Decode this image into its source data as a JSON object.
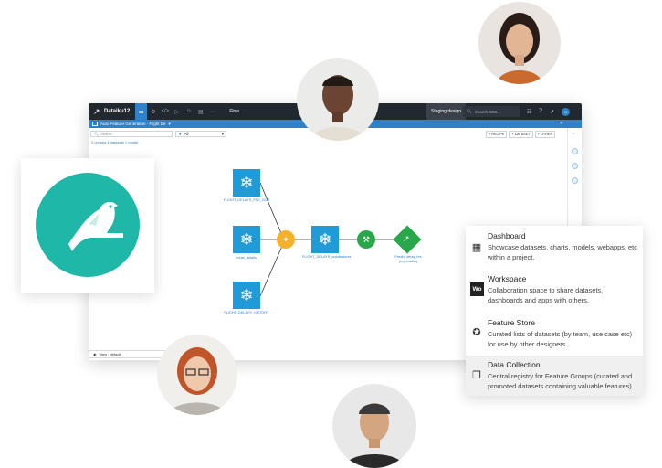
{
  "app": {
    "name": "Dataiku12",
    "nav_label": "Flow",
    "staging_label": "Staging design",
    "search_placeholder": "Search DSS...",
    "avatar_initial": "G"
  },
  "project": {
    "title": "Auto Feature Generation - Flight De"
  },
  "filter": {
    "search_placeholder": "Search",
    "selected": "All",
    "summary": "2 recipes 4 datasets 1 model"
  },
  "actions": {
    "recipe": "+ RECIPE",
    "dataset": "+ DATASET",
    "other": "+ OTHER"
  },
  "view": {
    "label": "View : default"
  },
  "flow": {
    "nodes": {
      "flight_delays_2022": "FLIGHT_DELAYS_FEE_2022",
      "route_details": "route_details",
      "flight_delays_history": "FLIGHT_DELAYS_HISTORY",
      "autofeatures": "FLIGHT_DELAYS_autofeatures",
      "predict": "Predict delay_hrs (regression)"
    }
  },
  "menu": {
    "items": [
      {
        "title": "Dashboard",
        "desc": "Showcase datasets, charts, models, webapps, etc within a project.",
        "icon": "dashboard-icon"
      },
      {
        "title": "Workspace",
        "desc": "Collaboration space to share datasets, dashboards and apps with others.",
        "badge": "Wo"
      },
      {
        "title": "Feature Store",
        "desc": "Curated lists of datasets (by team, use case etc) for use by other designers.",
        "icon": "badge-icon"
      },
      {
        "title": "Data Collection",
        "desc": "Central registry for Feature Groups (curated and promoted datasets containing valuable features).",
        "icon": "collection-icon"
      }
    ]
  },
  "colors": {
    "brand_teal": "#1fb8a8",
    "accent_blue": "#2d82c9",
    "dataset_blue": "#219ad8",
    "recipe_orange": "#f4b12c",
    "model_green": "#2aa74a",
    "topbar_dark": "#222830"
  }
}
